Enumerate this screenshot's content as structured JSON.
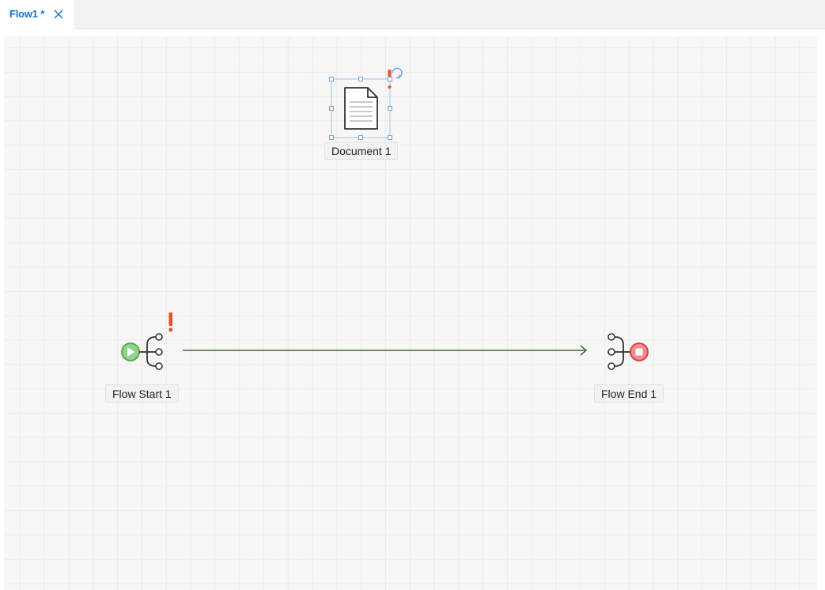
{
  "tabs": [
    {
      "label": "Flow1 *",
      "active": true
    }
  ],
  "canvas": {
    "nodes": {
      "document": {
        "label": "Document 1",
        "selected": true,
        "warning": true,
        "icon": "document-icon"
      },
      "flow_start": {
        "label": "Flow Start 1",
        "warning": true,
        "icon": "flow-start-icon"
      },
      "flow_end": {
        "label": "Flow End 1",
        "warning": false,
        "icon": "flow-end-icon"
      }
    },
    "connectors": [
      {
        "from": "Flow Start 1",
        "to": "Flow End 1",
        "color": "#3d6b35"
      }
    ]
  },
  "colors": {
    "accent": "#1a73c7",
    "warning": "#e8502b",
    "start_green": "#5cb85c",
    "end_red": "#e05050",
    "selection": "#7fb0e6",
    "connector": "#3d6b35"
  }
}
